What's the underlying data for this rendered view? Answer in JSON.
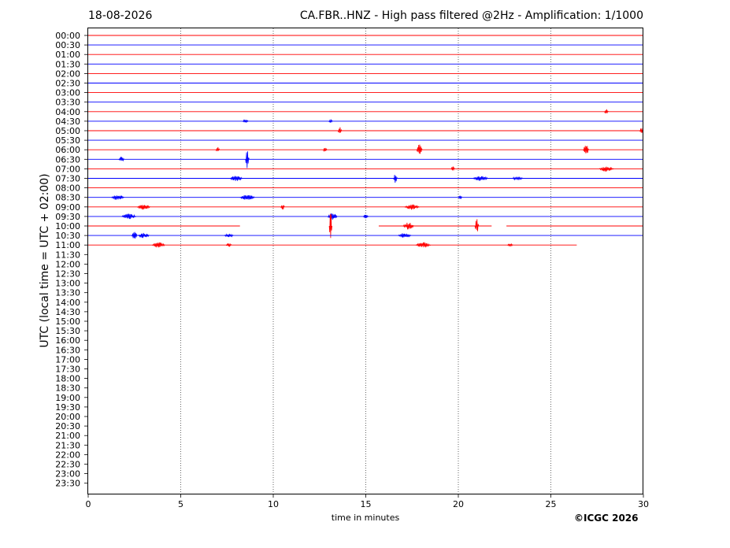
{
  "header": {
    "date": "18-08-2026",
    "title": "CA.FBR..HNZ - High pass filtered @2Hz - Amplification: 1/1000"
  },
  "footer": {
    "copyright": "©ICGC 2026"
  },
  "colors": {
    "trace_a": "#ff0000",
    "trace_b": "#0000ff",
    "grid": "#000000"
  },
  "chart_data": {
    "type": "line",
    "subtype": "helicorder",
    "title": "CA.FBR..HNZ - High pass filtered @2Hz - Amplification: 1/1000",
    "xlabel": "time in minutes",
    "ylabel": "UTC (local time = UTC + 02:00)",
    "xlim": [
      0,
      30
    ],
    "xticks": [
      0,
      5,
      10,
      15,
      20,
      25,
      30
    ],
    "grid": "vertical dotted lines at 5, 10, 15, 20, 25",
    "row_labels": [
      "00:00",
      "00:30",
      "01:00",
      "01:30",
      "02:00",
      "02:30",
      "03:00",
      "03:30",
      "04:00",
      "04:30",
      "05:00",
      "05:30",
      "06:00",
      "06:30",
      "07:00",
      "07:30",
      "08:00",
      "08:30",
      "09:00",
      "09:30",
      "10:00",
      "10:30",
      "11:00",
      "11:30",
      "12:00",
      "12:30",
      "13:00",
      "13:30",
      "14:00",
      "14:30",
      "15:00",
      "15:30",
      "16:00",
      "16:30",
      "17:00",
      "17:30",
      "18:00",
      "18:30",
      "19:00",
      "19:30",
      "20:00",
      "20:30",
      "21:00",
      "21:30",
      "22:00",
      "22:30",
      "23:00",
      "23:30"
    ],
    "traces": [
      {
        "row": "00:00",
        "color": "red",
        "end": 30,
        "events": []
      },
      {
        "row": "00:30",
        "color": "blue",
        "end": 30,
        "events": []
      },
      {
        "row": "01:00",
        "color": "red",
        "end": 30,
        "events": []
      },
      {
        "row": "01:30",
        "color": "blue",
        "end": 30,
        "events": []
      },
      {
        "row": "02:00",
        "color": "red",
        "end": 30,
        "events": []
      },
      {
        "row": "02:30",
        "color": "blue",
        "end": 30,
        "events": []
      },
      {
        "row": "03:00",
        "color": "red",
        "end": 30,
        "events": []
      },
      {
        "row": "03:30",
        "color": "blue",
        "end": 30,
        "events": []
      },
      {
        "row": "04:00",
        "color": "red",
        "end": 30,
        "events": [
          [
            28.0,
            0.3,
            0.2
          ]
        ]
      },
      {
        "row": "04:30",
        "color": "blue",
        "end": 30,
        "events": [
          [
            8.5,
            0.2,
            0.3
          ],
          [
            13.1,
            0.2,
            0.2
          ]
        ]
      },
      {
        "row": "05:00",
        "color": "red",
        "end": 30,
        "events": [
          [
            13.6,
            0.4,
            0.2
          ],
          [
            29.9,
            0.3,
            0.2
          ]
        ]
      },
      {
        "row": "05:30",
        "color": "blue",
        "end": 30,
        "events": []
      },
      {
        "row": "06:00",
        "color": "red",
        "end": 30,
        "events": [
          [
            7.0,
            0.3,
            0.2
          ],
          [
            12.8,
            0.3,
            0.2
          ],
          [
            17.9,
            0.6,
            0.3
          ],
          [
            26.9,
            0.6,
            0.3
          ]
        ]
      },
      {
        "row": "06:30",
        "color": "blue",
        "end": 30,
        "events": [
          [
            1.8,
            0.3,
            0.3
          ],
          [
            8.6,
            1.0,
            0.2
          ]
        ]
      },
      {
        "row": "07:00",
        "color": "red",
        "end": 30,
        "events": [
          [
            19.7,
            0.3,
            0.2
          ],
          [
            28.0,
            0.3,
            0.8
          ]
        ]
      },
      {
        "row": "07:30",
        "color": "blue",
        "end": 30,
        "events": [
          [
            8.0,
            0.3,
            0.7
          ],
          [
            16.6,
            0.5,
            0.2
          ],
          [
            21.2,
            0.3,
            0.8
          ],
          [
            23.2,
            0.2,
            0.6
          ]
        ]
      },
      {
        "row": "08:00",
        "color": "red",
        "end": 30,
        "events": []
      },
      {
        "row": "08:30",
        "color": "blue",
        "end": 30,
        "events": [
          [
            1.6,
            0.3,
            0.7
          ],
          [
            8.6,
            0.3,
            0.8
          ],
          [
            20.1,
            0.2,
            0.2
          ]
        ]
      },
      {
        "row": "09:00",
        "color": "red",
        "end": 30,
        "events": [
          [
            3.0,
            0.3,
            0.7
          ],
          [
            10.5,
            0.4,
            0.2
          ],
          [
            17.5,
            0.3,
            0.8
          ]
        ]
      },
      {
        "row": "09:30",
        "color": "blue",
        "end": 30,
        "events": [
          [
            2.2,
            0.3,
            0.8
          ],
          [
            13.2,
            0.5,
            0.5
          ],
          [
            15.0,
            0.2,
            0.3
          ]
        ]
      },
      {
        "row": "10:00",
        "color": "red",
        "end": 30,
        "gaps": [
          [
            8.2,
            15.7
          ],
          [
            21.8,
            22.6
          ]
        ],
        "events": [
          [
            13.1,
            2.0,
            0.15
          ],
          [
            17.3,
            0.4,
            0.6
          ],
          [
            21.0,
            0.8,
            0.2
          ]
        ]
      },
      {
        "row": "10:30",
        "color": "blue",
        "end": 30,
        "events": [
          [
            2.5,
            0.4,
            0.3
          ],
          [
            3.0,
            0.3,
            0.6
          ],
          [
            7.6,
            0.2,
            0.5
          ],
          [
            17.1,
            0.3,
            0.7
          ]
        ]
      },
      {
        "row": "11:00",
        "color": "red",
        "end": 26.4,
        "events": [
          [
            3.8,
            0.3,
            0.7
          ],
          [
            7.6,
            0.2,
            0.3
          ],
          [
            18.1,
            0.3,
            0.8
          ],
          [
            22.8,
            0.2,
            0.3
          ]
        ]
      }
    ]
  }
}
